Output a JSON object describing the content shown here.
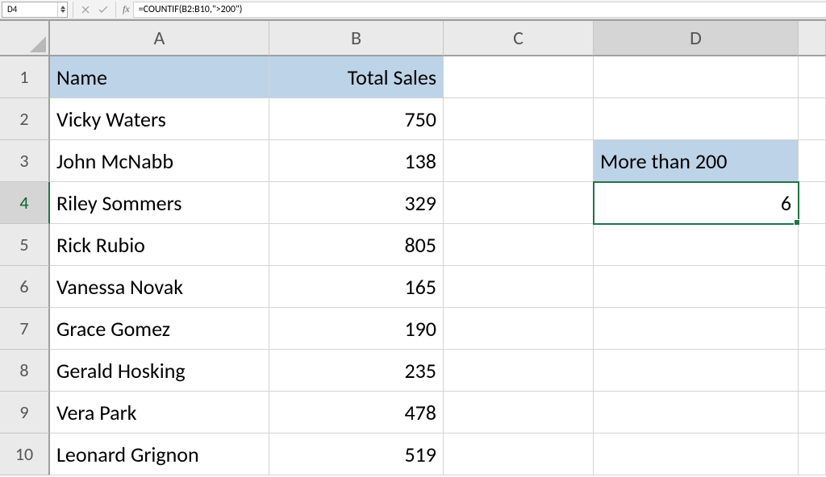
{
  "nameBox": "D4",
  "formula": "=COUNTIF(B2:B10,\">200\")",
  "columns": [
    "A",
    "B",
    "C",
    "D",
    ""
  ],
  "rows": [
    "1",
    "2",
    "3",
    "4",
    "5",
    "6",
    "7",
    "8",
    "9",
    "10"
  ],
  "headers": {
    "A": "Name",
    "B": "Total Sales"
  },
  "records": [
    {
      "name": "Vicky Waters",
      "sales": "750"
    },
    {
      "name": "John McNabb",
      "sales": "138"
    },
    {
      "name": "Riley Sommers",
      "sales": "329"
    },
    {
      "name": "Rick Rubio",
      "sales": "805"
    },
    {
      "name": "Vanessa Novak",
      "sales": "165"
    },
    {
      "name": "Grace Gomez",
      "sales": "190"
    },
    {
      "name": "Gerald Hosking",
      "sales": "235"
    },
    {
      "name": "Vera Park",
      "sales": "478"
    },
    {
      "name": "Leonard Grignon",
      "sales": "519"
    }
  ],
  "resultLabel": "More than 200",
  "resultValue": "6",
  "activeCell": "D4",
  "fx": "fx"
}
